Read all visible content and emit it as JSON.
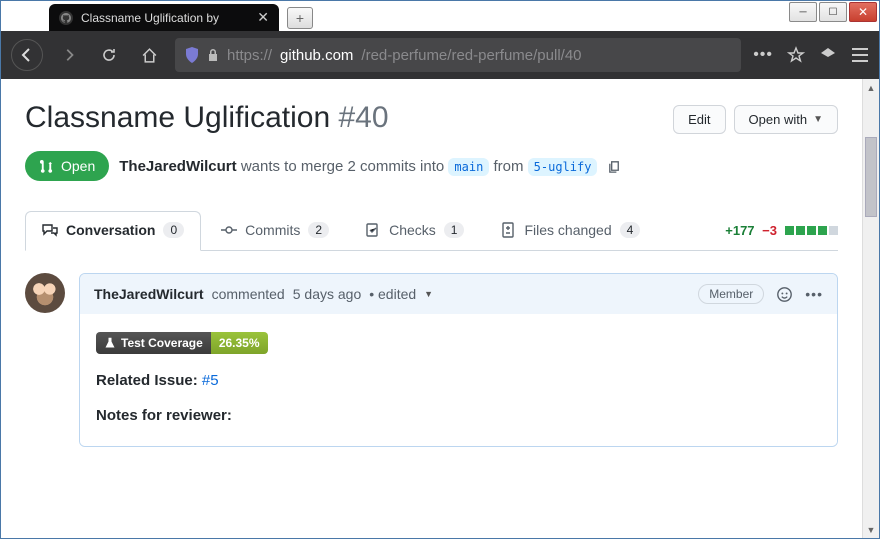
{
  "browser": {
    "tab_title": "Classname Uglification by",
    "url_proto": "https://",
    "url_host": "github.com",
    "url_path": "/red-perfume/red-perfume/pull/40"
  },
  "header": {
    "title": "Classname Uglification",
    "number": "#40",
    "edit": "Edit",
    "open_with": "Open with"
  },
  "state": {
    "label": "Open"
  },
  "merge": {
    "author": "TheJaredWilcurt",
    "text1": " wants to merge 2 commits into ",
    "base": "main",
    "text2": " from ",
    "head": "5-uglify"
  },
  "tabs": {
    "conversation": {
      "label": "Conversation",
      "count": "0"
    },
    "commits": {
      "label": "Commits",
      "count": "2"
    },
    "checks": {
      "label": "Checks",
      "count": "1"
    },
    "files": {
      "label": "Files changed",
      "count": "4"
    }
  },
  "diff": {
    "additions": "+177",
    "deletions": "−3"
  },
  "comment": {
    "author": "TheJaredWilcurt",
    "verb": " commented ",
    "when": "5 days ago",
    "edited": " • edited",
    "role": "Member",
    "coverage_label": "Test Coverage",
    "coverage_value": "26.35%",
    "related_prefix": "Related Issue: ",
    "related_link": "#5",
    "notes": "Notes for reviewer:"
  }
}
